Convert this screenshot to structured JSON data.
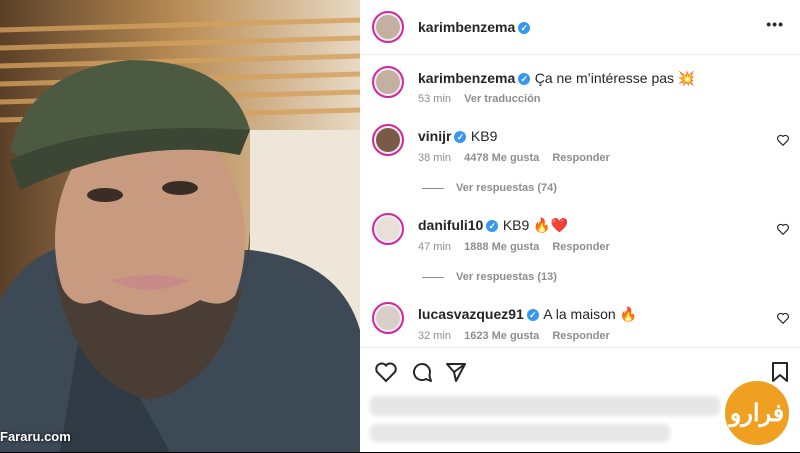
{
  "post": {
    "username": "karimbenzema",
    "more_label": "•••"
  },
  "caption": {
    "username": "karimbenzema",
    "text": "Ça ne m’intéresse pas 💥",
    "time": "53 min",
    "translate": "Ver traducción"
  },
  "comments": [
    {
      "username": "vinijr",
      "text": "KB9",
      "time": "38 min",
      "likes": "4478 Me gusta",
      "reply": "Responder",
      "view_replies": "Ver respuestas (74)"
    },
    {
      "username": "danifuli10",
      "text": "KB9 🔥❤️",
      "time": "47 min",
      "likes": "1888 Me gusta",
      "reply": "Responder",
      "view_replies": "Ver respuestas (13)"
    },
    {
      "username": "lucasvazquez91",
      "text": "A la maison 🔥",
      "time": "32 min",
      "likes": "1623 Me gusta",
      "reply": "Responder"
    }
  ],
  "watermark": {
    "site": "Fararu.com",
    "logo_text": "فرارو"
  },
  "colors": {
    "verified": "#3897f0",
    "muted": "#8e8e8e",
    "text": "#262626"
  }
}
